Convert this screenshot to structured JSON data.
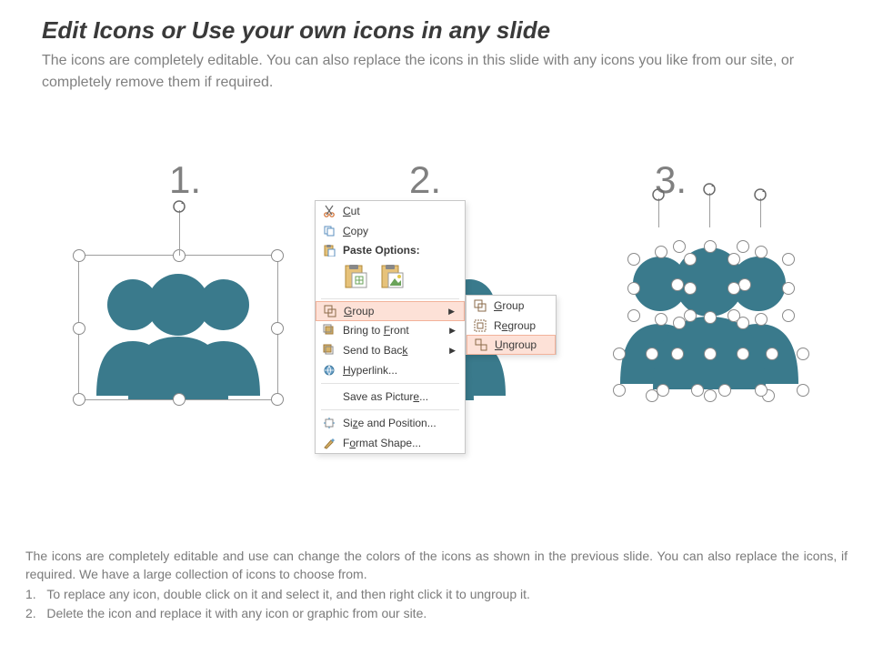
{
  "title": "Edit Icons or Use your own icons in any slide",
  "subtitle": "The icons are completely editable. You can also replace the icons in this slide with any icons you like from our site, or completely remove them if required.",
  "columns": {
    "one": "1.",
    "two": "2.",
    "three": "3."
  },
  "iconColor": "#3a7a8c",
  "handleColor": "#9e9e9e",
  "context_menu": {
    "cut": "Cut",
    "copy": "Copy",
    "paste_label": "Paste Options:",
    "group": "Group",
    "bring_front": "Bring to Front",
    "send_back": "Send to Back",
    "hyperlink": "Hyperlink...",
    "save_picture": "Save as Picture...",
    "size_position": "Size and Position...",
    "format_shape": "Format Shape..."
  },
  "submenu": {
    "group": "Group",
    "regroup": "Regroup",
    "ungroup": "Ungroup"
  },
  "bottom": {
    "para": "The icons are completely editable and use can change the colors of the icons as shown in the previous slide. You can also replace the icons, if required. We have a large collection of icons to choose from.",
    "step1_no": "1.",
    "step1": "To replace any icon, double click on it and select it, and then right click it to ungroup it.",
    "step2_no": "2.",
    "step2": "Delete the icon and replace it with any icon or graphic from our site."
  }
}
